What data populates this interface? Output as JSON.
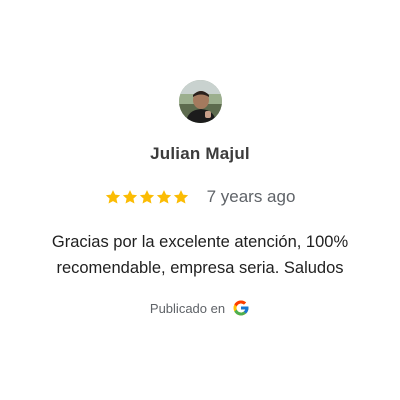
{
  "review": {
    "author_name": "Julian Majul",
    "rating": 5,
    "max_rating": 5,
    "time_ago": "7 years ago",
    "text": "Gracias por la excelente atención, 100% recomendable, empresa seria. Saludos",
    "source_label": "Publicado en",
    "source_icon": "google-icon"
  },
  "colors": {
    "star": "#fbbc04",
    "name": "#3c3c3c",
    "muted": "#5f6368",
    "body": "#1f1f1f"
  }
}
